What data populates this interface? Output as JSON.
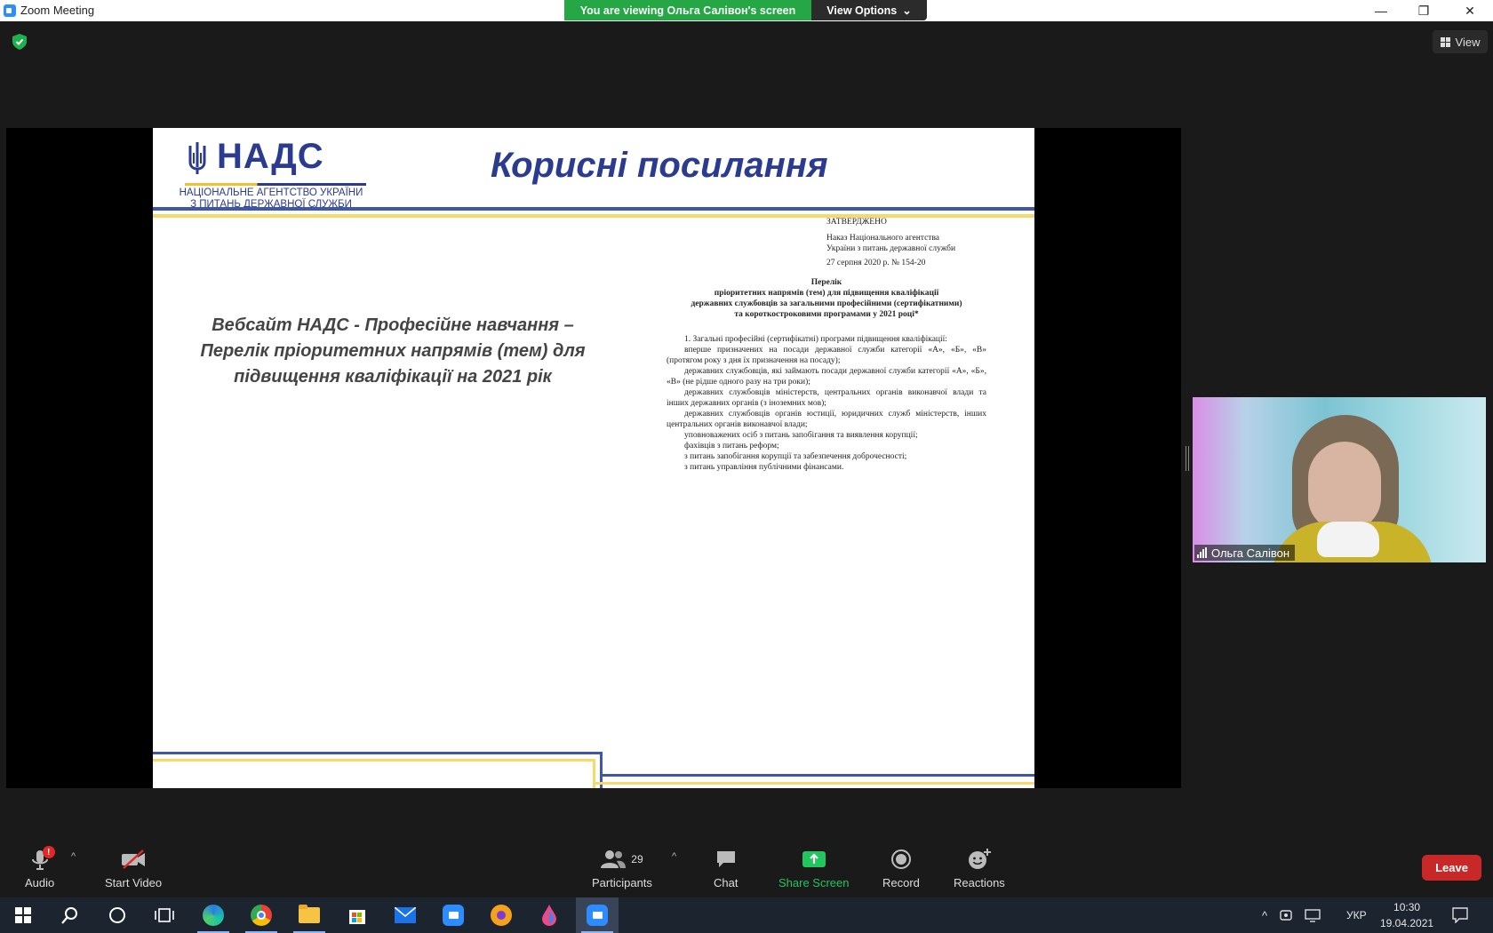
{
  "window": {
    "title": "Zoom Meeting",
    "minimize_glyph": "—",
    "restore_glyph": "❐",
    "close_glyph": "✕"
  },
  "share_banner": {
    "text": "You are viewing Ольга Салівон's screen",
    "view_options_label": "View Options",
    "color": "#25a745"
  },
  "top_right": {
    "view_label": "View"
  },
  "slide": {
    "logo_text": "НАДС",
    "logo_subtitle_line1": "НАЦІОНАЛЬНЕ АГЕНТСТВО УКРАЇНИ",
    "logo_subtitle_line2": "З ПИТАНЬ ДЕРЖАВНОЇ СЛУЖБИ",
    "title": "Корисні посилання",
    "body_line1": "Вебсайт НАДС - Професійне навчання –",
    "body_line2": "Перелік пріоритетних напрямів (тем) для",
    "body_line3": "підвищення кваліфікації на 2021 рік",
    "accent_blue": "#2b3b8f",
    "accent_yellow": "#f6d96a"
  },
  "document": {
    "approved": "ЗАТВЕРДЖЕНО",
    "order_line1": "Наказ Національного агентства",
    "order_line2": "України з питань державної служби",
    "order_date": "27 серпня 2020 р. № 154-20",
    "heading_1": "Перелік",
    "heading_2": "пріоритетних напрямів (тем) для підвищення кваліфікації",
    "heading_3": "державних службовців за загальними професійними (сертифікатними)",
    "heading_4": "та короткостроковими програмами у 2021 році*",
    "items": [
      "1. Загальні професійні (сертифікатні) програми підвищення кваліфікації:",
      "вперше призначених на посади державної служби категорії «А», «Б», «В» (протягом року з дня їх призначення на посаду);",
      "державних службовців, які займають посади державної служби категорії «А», «Б», «В» (не рідше одного разу на три роки);",
      "державних службовців міністерств, центральних органів виконавчої влади та інших державних органів (з іноземних мов);",
      "державних службовців органів юстиції, юридичних служб міністерств, інших центральних органів виконавчої влади;",
      "уповноважених осіб з питань запобігання та виявлення корупції;",
      "фахівців з питань реформ;",
      "з питань запобігання корупції та забезпечення доброчесності;",
      "з питань управління публічними фінансами."
    ]
  },
  "participant": {
    "name": "Ольга Салівон"
  },
  "toolbar": {
    "audio_label": "Audio",
    "audio_badge": "!",
    "start_video_label": "Start Video",
    "participants_label": "Participants",
    "participants_count": "29",
    "chat_label": "Chat",
    "share_screen_label": "Share Screen",
    "record_label": "Record",
    "reactions_label": "Reactions",
    "leave_label": "Leave",
    "share_color": "#22c55e",
    "leave_color": "#c82828"
  },
  "taskbar": {
    "language": "УКР",
    "time": "10:30",
    "date": "19.04.2021",
    "icons": [
      "windows-start-icon",
      "search-icon",
      "cortana-icon",
      "task-view-icon",
      "edge-icon",
      "chrome-icon",
      "file-explorer-icon",
      "store-icon",
      "mail-icon",
      "zoom-icon",
      "vpn-icon",
      "paint-icon",
      "zoom-active-icon"
    ]
  }
}
